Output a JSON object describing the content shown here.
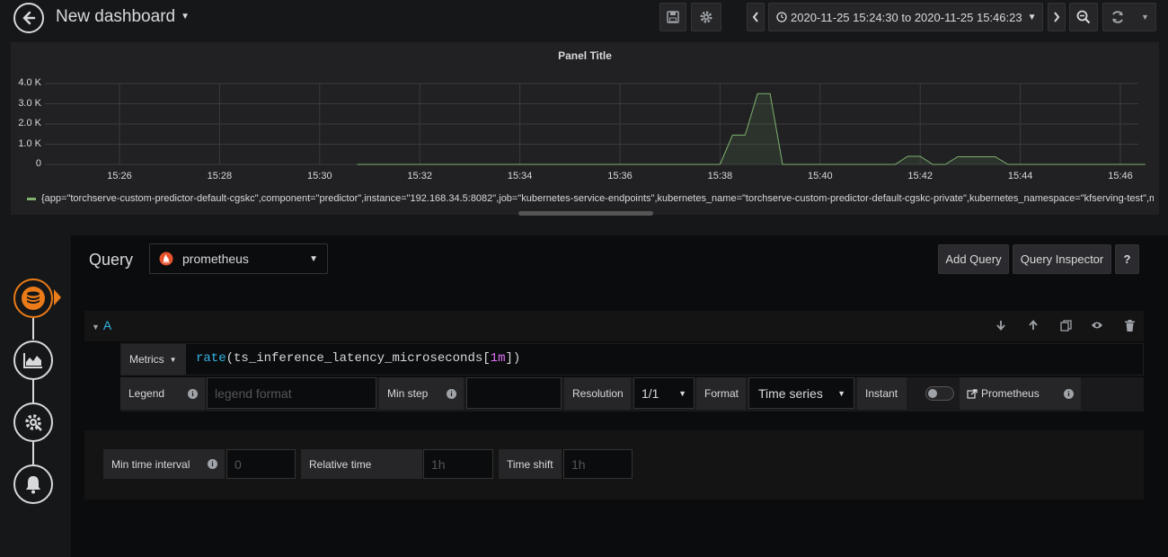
{
  "header": {
    "title": "New dashboard",
    "time_range": "2020-11-25 15:24:30 to 2020-11-25 15:46:23"
  },
  "panel": {
    "title": "Panel Title",
    "legend": "{app=\"torchserve-custom-predictor-default-cgskc\",component=\"predictor\",instance=\"192.168.34.5:8082\",job=\"kubernetes-service-endpoints\",kubernetes_name=\"torchserve-custom-predictor-default-cgskc-private\",kubernetes_namespace=\"kfserving-test\",ma"
  },
  "chart_data": {
    "type": "area",
    "title": "Panel Title",
    "x_ticks": [
      "15:26",
      "15:28",
      "15:30",
      "15:32",
      "15:34",
      "15:36",
      "15:38",
      "15:40",
      "15:42",
      "15:44",
      "15:46"
    ],
    "y_ticks": [
      "4.0 K",
      "3.0 K",
      "2.0 K",
      "1.0 K",
      "0"
    ],
    "ylim": [
      0,
      4000
    ],
    "grid": true,
    "series": [
      {
        "color": "#7eb26d",
        "points": [
          [
            "15:30:45",
            0
          ],
          [
            "15:37:30",
            0
          ],
          [
            "15:38",
            0
          ],
          [
            "15:38:15",
            1450
          ],
          [
            "15:38:30",
            1450
          ],
          [
            "15:38:45",
            3500
          ],
          [
            "15:39",
            3500
          ],
          [
            "15:39:15",
            0
          ],
          [
            "15:41:30",
            0
          ],
          [
            "15:41:45",
            400
          ],
          [
            "15:42",
            400
          ],
          [
            "15:42:15",
            0
          ],
          [
            "15:42:30",
            0
          ],
          [
            "15:42:45",
            380
          ],
          [
            "15:43:30",
            380
          ],
          [
            "15:43:45",
            0
          ],
          [
            "15:46:30",
            0
          ]
        ]
      }
    ]
  },
  "editor": {
    "query_label": "Query",
    "datasource": "prometheus",
    "add_query": "Add Query",
    "query_inspector": "Query Inspector",
    "help": "?",
    "row_letter": "A",
    "metrics_label": "Metrics",
    "promql": {
      "fn": "rate",
      "open": "(",
      "metric": "ts_inference_latency_microseconds[",
      "range": "1m",
      "close": "])"
    },
    "legend_label": "Legend",
    "legend_placeholder": "legend format",
    "min_step_label": "Min step",
    "resolution_label": "Resolution",
    "resolution_value": "1/1",
    "format_label": "Format",
    "format_value": "Time series",
    "instant_label": "Instant",
    "prometheus_link": "Prometheus"
  },
  "options": {
    "min_interval_label": "Min time interval",
    "min_interval_placeholder": "0",
    "relative_time_label": "Relative time",
    "relative_time_placeholder": "1h",
    "time_shift_label": "Time shift",
    "time_shift_placeholder": "1h"
  }
}
